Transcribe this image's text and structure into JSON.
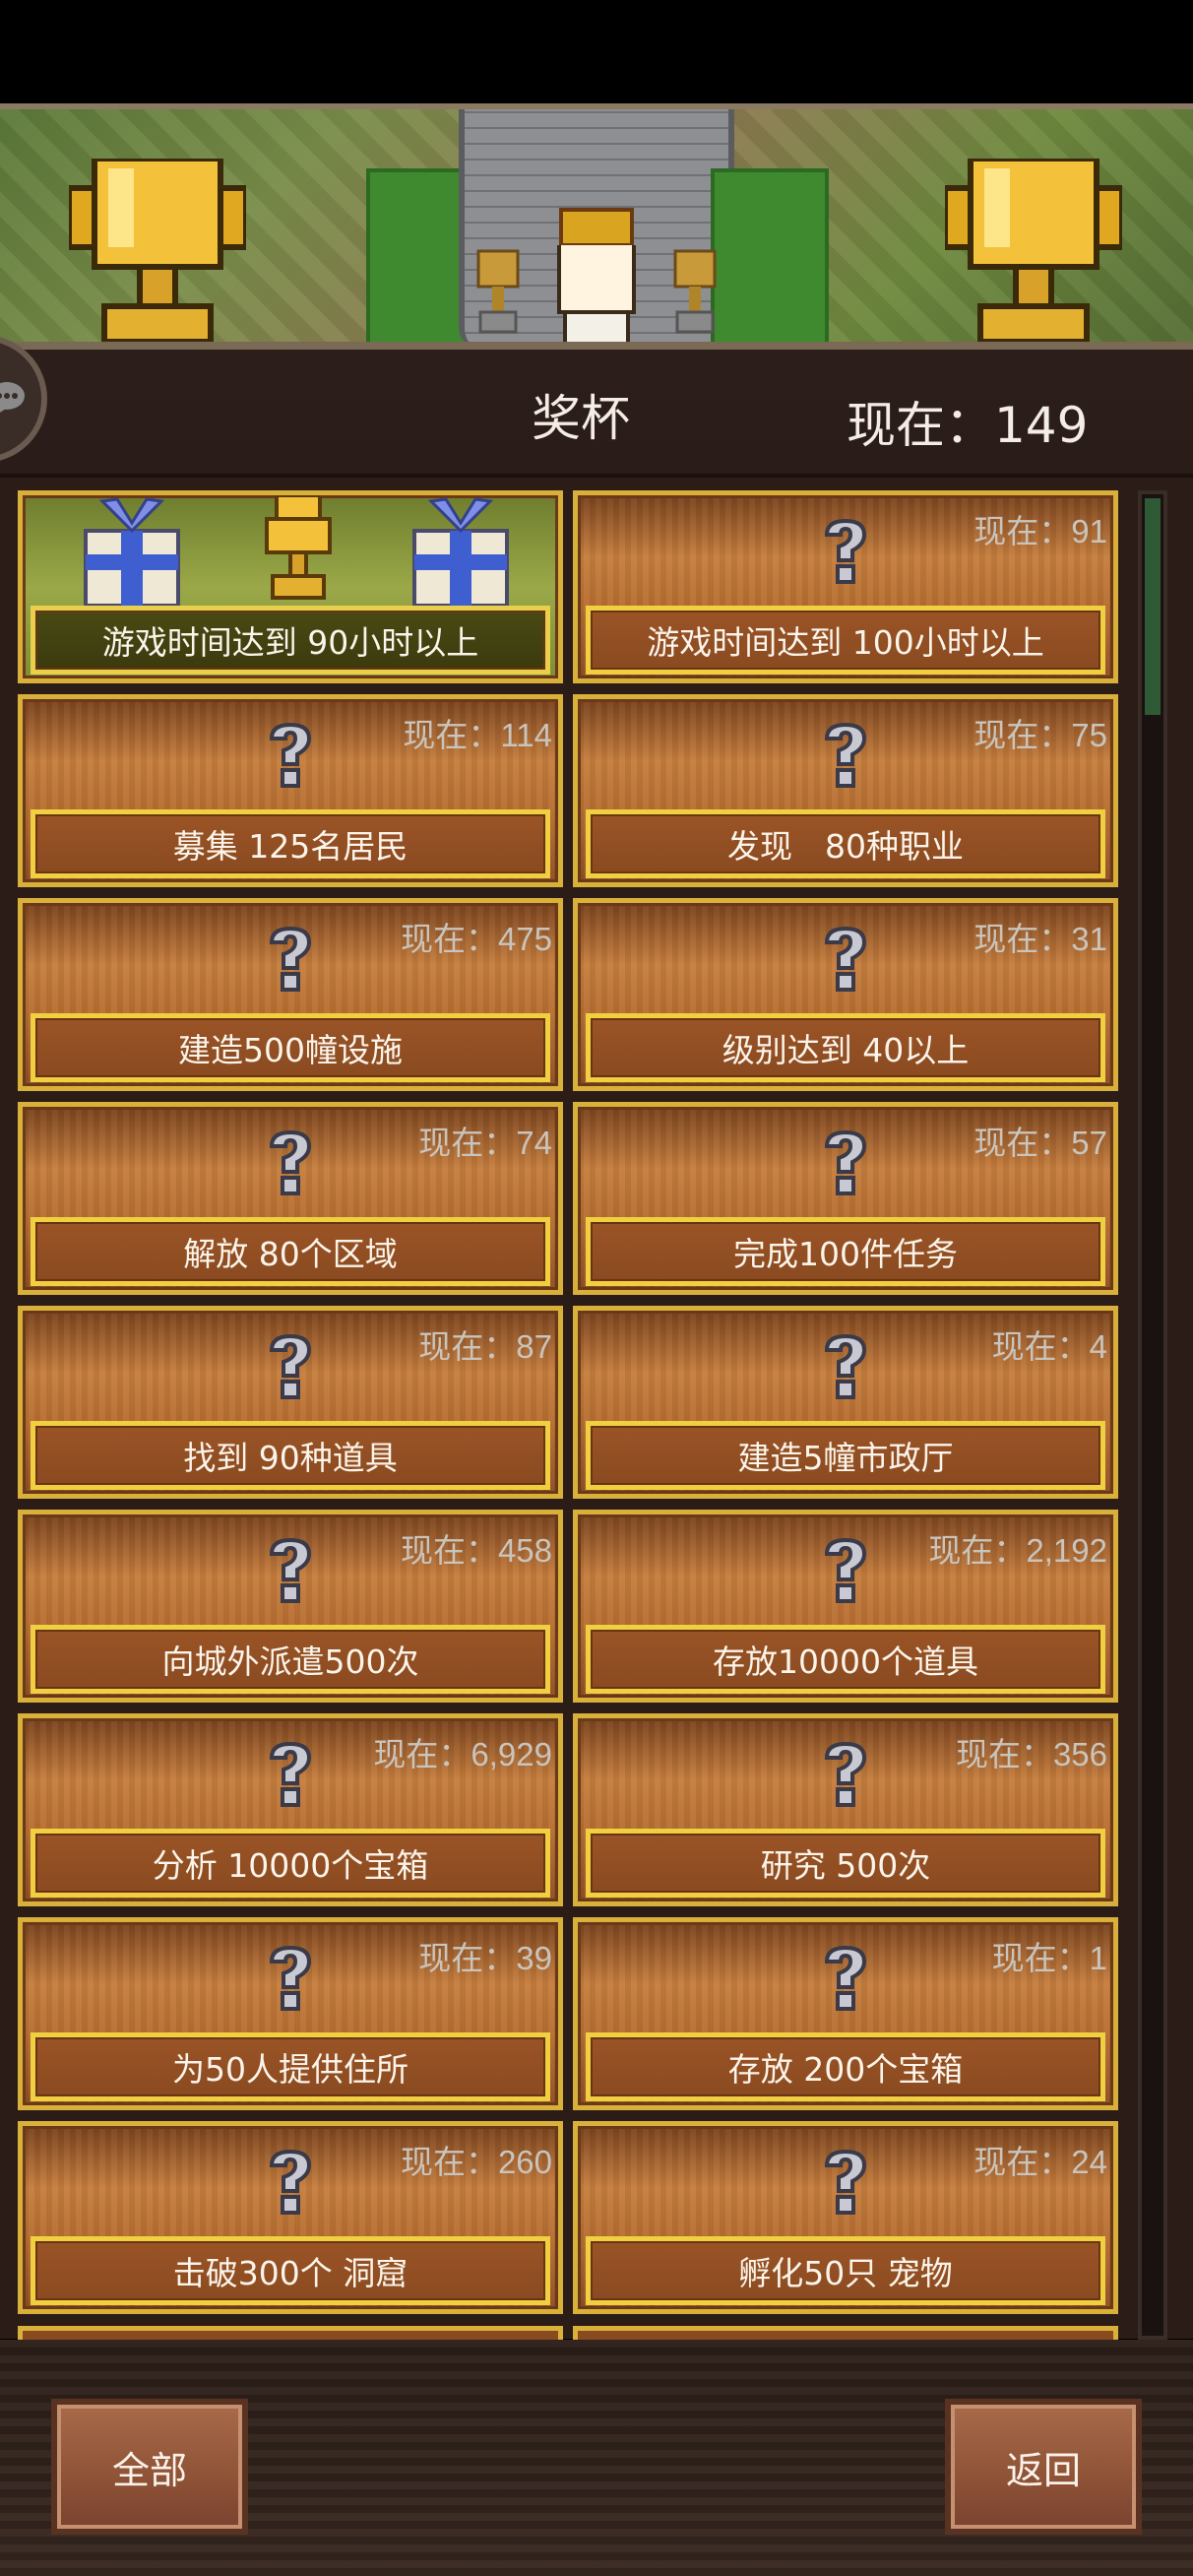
{
  "header": {
    "title": "奖杯",
    "now_total": "现在：149"
  },
  "achievements": [
    {
      "label": "游戏时间达到 90小时以上",
      "now": "",
      "achieved": true
    },
    {
      "label": "游戏时间达到 100小时以上",
      "now": "现在：91",
      "achieved": false
    },
    {
      "label": "募集 125名居民",
      "now": "现在：114",
      "achieved": false
    },
    {
      "label": "发现　80种职业",
      "now": "现在：75",
      "achieved": false
    },
    {
      "label": "建造500幢设施",
      "now": "现在：475",
      "achieved": false
    },
    {
      "label": "级别达到 40以上",
      "now": "现在：31",
      "achieved": false
    },
    {
      "label": "解放 80个区域",
      "now": "现在：74",
      "achieved": false
    },
    {
      "label": "完成100件任务",
      "now": "现在：57",
      "achieved": false
    },
    {
      "label": "找到 90种道具",
      "now": "现在：87",
      "achieved": false
    },
    {
      "label": "建造5幢市政厅",
      "now": "现在：4",
      "achieved": false
    },
    {
      "label": "向城外派遣500次",
      "now": "现在：458",
      "achieved": false
    },
    {
      "label": "存放10000个道具",
      "now": "现在：2,192",
      "achieved": false
    },
    {
      "label": "分析 10000个宝箱",
      "now": "现在：6,929",
      "achieved": false
    },
    {
      "label": "研究 500次",
      "now": "现在：356",
      "achieved": false
    },
    {
      "label": "为50人提供住所",
      "now": "现在：39",
      "achieved": false
    },
    {
      "label": "存放 200个宝箱",
      "now": "现在：1",
      "achieved": false
    },
    {
      "label": "击破300个 洞窟",
      "now": "现在：260",
      "achieved": false
    },
    {
      "label": "孵化50只 宠物",
      "now": "现在：24",
      "achieved": false
    }
  ],
  "buttons": {
    "all_label": "全部",
    "back_label": "返回"
  },
  "colors": {
    "card_border": "#d9b13a",
    "label_border": "#f0d040",
    "background": "#2b1c18"
  }
}
